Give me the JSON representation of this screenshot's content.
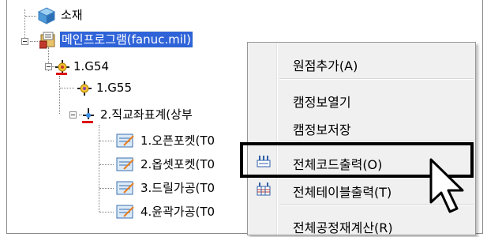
{
  "tree": {
    "nodes": [
      {
        "label": "소재"
      },
      {
        "label": "메인프로그램(fanuc.mil)"
      },
      {
        "label": "1.G54"
      },
      {
        "label": "1.G55"
      },
      {
        "label": "2.직교좌표계(상부"
      },
      {
        "label": "1.오픈포켓(T0"
      },
      {
        "label": "2.옵셋포켓(T0"
      },
      {
        "label": "3.드릴가공(T0"
      },
      {
        "label": "4.윤곽가공(T0"
      }
    ]
  },
  "context_menu": {
    "items": [
      {
        "label": "원점추가(A)"
      },
      {
        "label": "캠정보열기"
      },
      {
        "label": "캠정보저장"
      },
      {
        "label": "전체코드출력(O)"
      },
      {
        "label": "전체테이블출력(T)"
      },
      {
        "label": "전체공정재계산(R)"
      }
    ]
  },
  "colors": {
    "selection": "#2f63d8",
    "menu_bg": "#f0f0f0",
    "highlight_border": "#000000"
  }
}
